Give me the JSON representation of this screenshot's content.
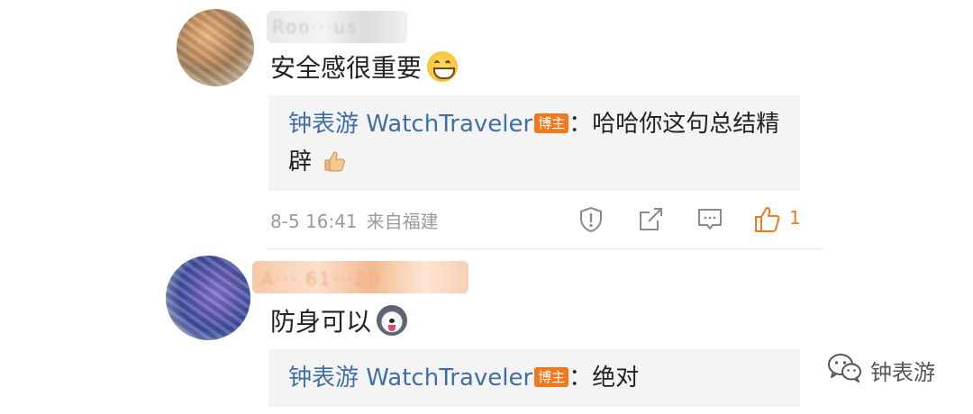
{
  "comments": [
    {
      "text": "安全感很重要",
      "emoji": "grinning-face-emoji",
      "reply": {
        "author": "钟表游 WatchTraveler",
        "badge": "博主",
        "separator": "：",
        "text_line1": "哈哈你这句总结精",
        "text_line2": "辟",
        "emoji": "thumbs-up-emoji"
      },
      "meta": {
        "time": "8-5 16:41",
        "location": "来自福建"
      },
      "actions": {
        "report_icon": "alert-shield-icon",
        "share_icon": "share-icon",
        "comment_icon": "comment-icon",
        "like_icon": "thumbs-up-icon",
        "like_count": "1"
      }
    },
    {
      "text": "防身可以",
      "emoji": "husky-dog-emoji",
      "reply": {
        "author": "钟表游 WatchTraveler",
        "badge": "博主",
        "separator": "：",
        "text_line1": "绝对"
      }
    }
  ],
  "watermark": {
    "icon": "wechat-icon",
    "label": "钟表游"
  },
  "colors": {
    "author_link": "#3f6fa6",
    "badge": "#f2781e",
    "like_active": "#f2781e",
    "meta_text": "#9b9b9b",
    "reply_bg": "#f4f4f4"
  }
}
